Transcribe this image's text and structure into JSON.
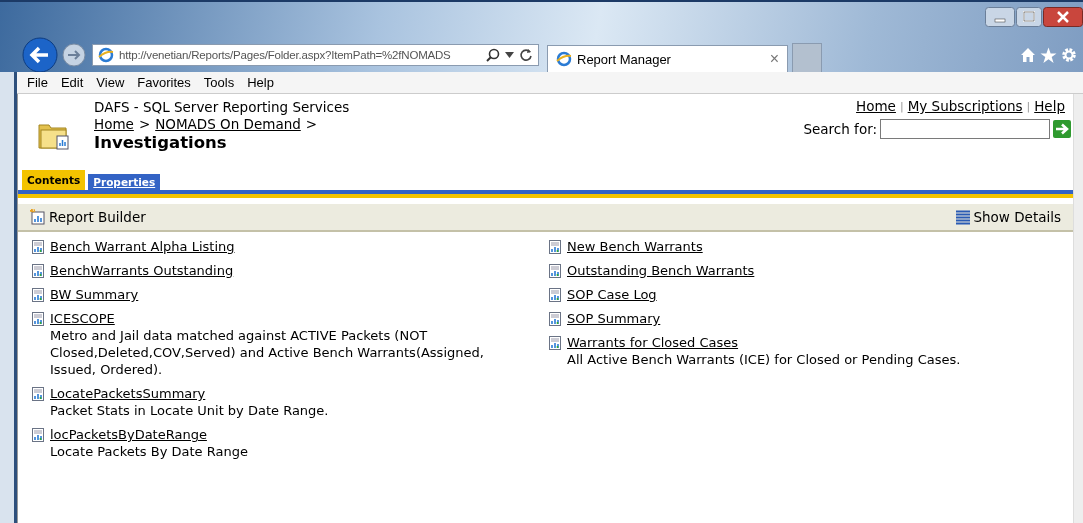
{
  "browser": {
    "address": "http://venetian/Reports/Pages/Folder.aspx?ItemPath=%2fNOMADS",
    "tabs": [
      {
        "label": "Report Manager",
        "close": "×",
        "selected": true
      }
    ]
  },
  "menu": [
    "File",
    "Edit",
    "View",
    "Favorites",
    "Tools",
    "Help"
  ],
  "header": {
    "site": "DAFS - SQL Server Reporting Services",
    "breadcrumb": [
      {
        "kind": "link",
        "label": "Home"
      },
      {
        "kind": "sep",
        "label": ">"
      },
      {
        "kind": "link",
        "label": "NOMADS On Demand"
      },
      {
        "kind": "sep",
        "label": ">"
      }
    ],
    "title": "Investigations",
    "top_links": [
      {
        "kind": "link",
        "label": "Home"
      },
      {
        "kind": "sep",
        "label": "|"
      },
      {
        "kind": "link",
        "label": "My Subscriptions"
      },
      {
        "kind": "sep",
        "label": "|"
      },
      {
        "kind": "link",
        "label": "Help"
      }
    ],
    "search": {
      "label": "Search for:"
    }
  },
  "tabs": [
    {
      "label": "Contents",
      "selected": true
    },
    {
      "label": "Properties",
      "selected": false
    }
  ],
  "toolbar": {
    "left": "Report Builder",
    "right": "Show Details"
  },
  "columns": [
    [
      {
        "name": "Bench Warrant Alpha Listing"
      },
      {
        "name": "BenchWarrants Outstanding"
      },
      {
        "name": "BW Summary"
      },
      {
        "name": "ICESCOPE",
        "description": "Metro and Jail data matched against ACTIVE Packets (NOT Closed,Deleted,COV,Served) and Active Bench Warrants(Assigned, Issued, Ordered)."
      },
      {
        "name": "LocatePacketsSummary",
        "description": "Packet Stats in Locate Unit by Date Range."
      },
      {
        "name": "locPacketsByDateRange",
        "description": "Locate Packets By Date Range"
      }
    ],
    [
      {
        "name": "New Bench Warrants"
      },
      {
        "name": "Outstanding Bench Warrants"
      },
      {
        "name": "SOP Case Log"
      },
      {
        "name": "SOP Summary"
      },
      {
        "name": "Warrants for Closed Cases",
        "description": "All Active Bench Warrants (ICE) for Closed or Pending Cases."
      }
    ]
  ]
}
